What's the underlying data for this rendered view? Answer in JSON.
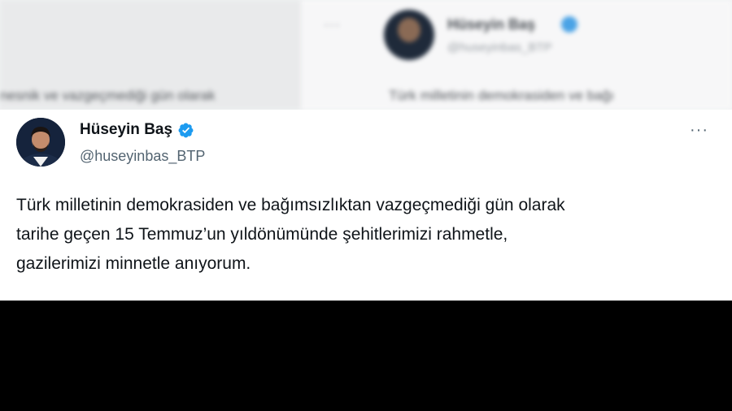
{
  "background": {
    "more_glyph": "···",
    "name": "Hüseyin Baş",
    "handle": "@huseyinbas_BTP",
    "left_text": "nesnik ve vazgeçmediği gün olarak",
    "right_text": "Türk milletinin demokrasiden ve bağı"
  },
  "tweet": {
    "author_name": "Hüseyin Baş",
    "author_handle": "@huseyinbas_BTP",
    "verified_icon": "verified-badge-icon",
    "more_glyph": "···",
    "lines": [
      "Türk milletinin demokrasiden ve bağımsızlıktan vazgeçmediği gün olarak",
      "tarihe geçen 15 Temmuz’un yıldönümünde şehitlerimizi rahmetle,",
      "gazilerimizi minnetle anıyorum."
    ]
  },
  "colors": {
    "text": "#0f1419",
    "secondary": "#536471",
    "verified": "#1d9bf0"
  }
}
